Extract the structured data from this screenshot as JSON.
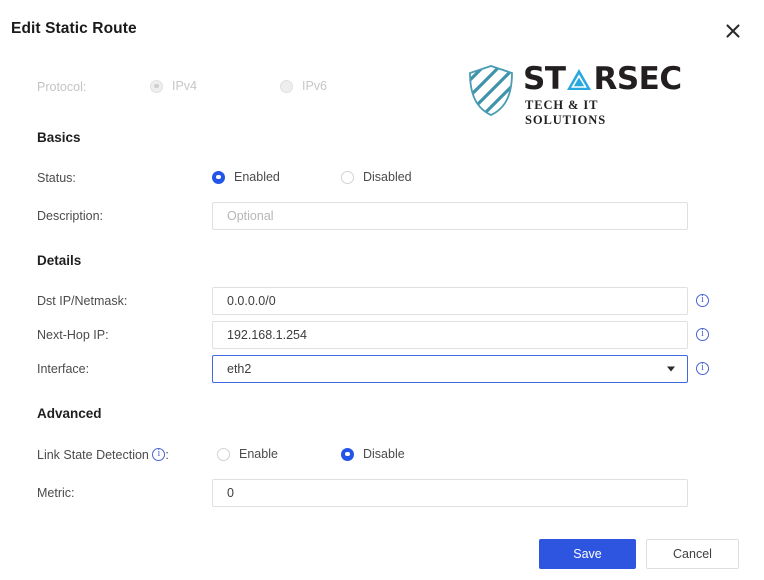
{
  "dialog": {
    "title": "Edit Static Route",
    "close_icon": "close-icon"
  },
  "logo": {
    "word_pre": "ST",
    "word_post": "RSEC",
    "tagline": "TECH & IT SOLUTIONS",
    "shield_color": "#3f93ab",
    "triangle_color": "#29a8e0"
  },
  "protocol": {
    "label": "Protocol:",
    "disabled": true,
    "options": [
      {
        "label": "IPv4",
        "checked": true
      },
      {
        "label": "IPv6",
        "checked": false
      }
    ]
  },
  "sections": {
    "basics": "Basics",
    "details": "Details",
    "advanced": "Advanced"
  },
  "status": {
    "label": "Status:",
    "options": [
      {
        "label": "Enabled",
        "checked": true
      },
      {
        "label": "Disabled",
        "checked": false
      }
    ]
  },
  "description": {
    "label": "Description:",
    "value": "",
    "placeholder": "Optional"
  },
  "dst": {
    "label": "Dst IP/Netmask:",
    "value": "0.0.0.0/0",
    "info_icon": "info-icon"
  },
  "nexthop": {
    "label": "Next-Hop IP:",
    "value": "192.168.1.254",
    "info_icon": "info-icon"
  },
  "interface": {
    "label": "Interface:",
    "value": "eth2",
    "info_icon": "info-icon",
    "caret_icon": "chevron-down-icon",
    "focused": true
  },
  "link_state": {
    "label_text": "Link State Detection",
    "label_suffix": ":",
    "info_icon": "info-icon",
    "options": [
      {
        "label": "Enable",
        "checked": false
      },
      {
        "label": "Disable",
        "checked": true
      }
    ]
  },
  "metric": {
    "label": "Metric:",
    "value": "0"
  },
  "footer": {
    "save_label": "Save",
    "cancel_label": "Cancel",
    "primary_color": "#2e55e0"
  }
}
